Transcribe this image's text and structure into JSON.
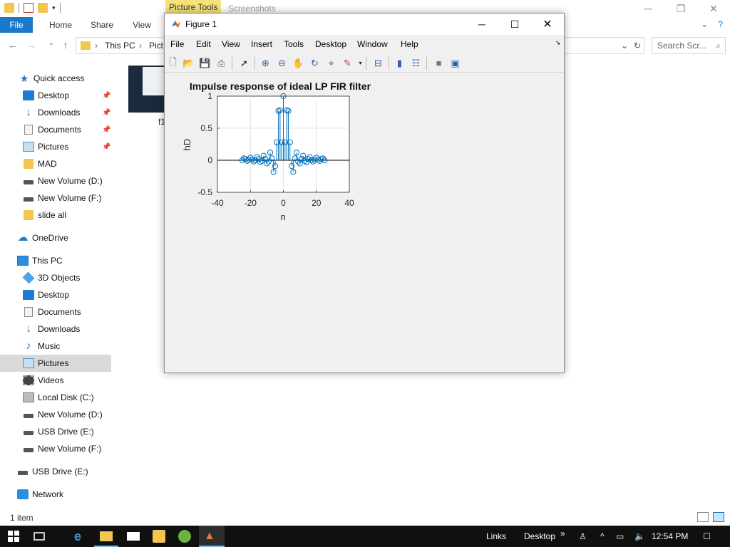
{
  "explorer": {
    "context_tab": "Picture Tools",
    "window_title": "Screenshots",
    "ribbon_tabs": [
      "File",
      "Home",
      "Share",
      "View"
    ],
    "breadcrumb": [
      "This PC",
      "Pict"
    ],
    "search_placeholder": "Search Scr...",
    "nav": {
      "quick_access": "Quick access",
      "quick_items": [
        "Desktop",
        "Downloads",
        "Documents",
        "Pictures",
        "MAD",
        "New Volume (D:)",
        "New Volume (F:)",
        "slide all"
      ],
      "onedrive": "OneDrive",
      "this_pc": "This PC",
      "pc_items": [
        "3D Objects",
        "Desktop",
        "Documents",
        "Downloads",
        "Music",
        "Pictures",
        "Videos",
        "Local Disk (C:)",
        "New Volume (D:)",
        "USB Drive (E:)",
        "New Volume (F:)"
      ],
      "usb": "USB Drive (E:)",
      "network": "Network"
    },
    "file_label": "f1",
    "status": "1 item"
  },
  "taskbar": {
    "links": "Links",
    "desktop": "Desktop",
    "clock": "12:54 PM"
  },
  "figure": {
    "title": "Figure 1",
    "menus": [
      "File",
      "Edit",
      "View",
      "Insert",
      "Tools",
      "Desktop",
      "Window",
      "Help"
    ]
  },
  "chart_data": {
    "type": "stem",
    "title": "Impulse response of ideal LP FIR filter",
    "xlabel": "n",
    "ylabel": "hD",
    "xlim": [
      -40,
      40
    ],
    "ylim": [
      -0.5,
      1
    ],
    "xticks": [
      "-40",
      "-20",
      "0",
      "20",
      "40"
    ],
    "yticks": [
      "-0.5",
      "0",
      "0.5",
      "1"
    ],
    "marker_color": "#0072bd",
    "x": [
      -25,
      -24,
      -23,
      -22,
      -21,
      -20,
      -19,
      -18,
      -17,
      -16,
      -15,
      -14,
      -13,
      -12,
      -11,
      -10,
      -9,
      -8,
      -7,
      -6,
      -5,
      -4,
      -3,
      -2,
      -1,
      0,
      1,
      2,
      3,
      4,
      5,
      6,
      7,
      8,
      9,
      10,
      11,
      12,
      13,
      14,
      15,
      16,
      17,
      18,
      19,
      20,
      21,
      22,
      23,
      24,
      25
    ],
    "y": [
      0.0,
      0.03,
      0.02,
      -0.01,
      0.01,
      0.04,
      0.01,
      -0.02,
      0.0,
      0.05,
      0.02,
      -0.03,
      -0.01,
      0.07,
      0.02,
      -0.05,
      -0.02,
      0.12,
      0.03,
      -0.18,
      -0.09,
      0.28,
      0.77,
      0.78,
      0.28,
      1.0,
      0.28,
      0.78,
      0.77,
      0.28,
      -0.09,
      -0.18,
      0.03,
      0.12,
      -0.02,
      -0.05,
      0.02,
      0.07,
      -0.01,
      -0.03,
      0.02,
      0.05,
      0.0,
      -0.02,
      0.01,
      0.04,
      0.01,
      -0.01,
      0.02,
      0.03,
      0.0
    ]
  }
}
